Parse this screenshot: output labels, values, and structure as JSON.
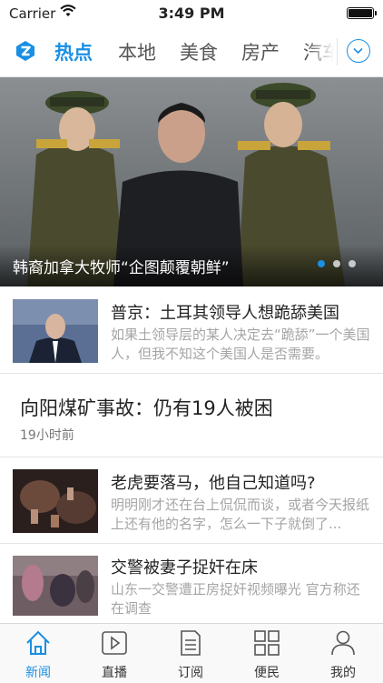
{
  "status_bar": {
    "carrier": "Carrier",
    "time": "3:49 PM"
  },
  "nav": {
    "tabs": [
      {
        "label": "热点",
        "active": true
      },
      {
        "label": "本地",
        "active": false
      },
      {
        "label": "美食",
        "active": false
      },
      {
        "label": "房产",
        "active": false
      },
      {
        "label": "汽车",
        "active": false
      }
    ],
    "logo_icon": "app-logo-icon",
    "expand_icon": "chevron-down-icon"
  },
  "hero": {
    "caption": "韩裔加拿大牧师“企图颠覆朝鲜”",
    "slide_count": 3,
    "active_slide": 1
  },
  "news": [
    {
      "title": "普京：土耳其领导人想跪舔美国",
      "summary": "如果土领导层的某人决定去“跪舔”一个美国人，但我不知这个美国人是否需要。"
    },
    {
      "title": "向阳煤矿事故：仍有19人被困",
      "time": "19小时前"
    },
    {
      "title": "老虎要落马，他自己知道吗?",
      "summary": "明明刚才还在台上侃侃而谈，或者今天报纸上还有他的名字，怎么一下子就倒了..."
    },
    {
      "title": "交警被妻子捉奸在床",
      "summary": "山东一交警遭正房捉奸视频曝光 官方称还在调查"
    }
  ],
  "tab_bar": [
    {
      "label": "新闻",
      "icon": "home-icon",
      "active": true
    },
    {
      "label": "直播",
      "icon": "play-icon",
      "active": false
    },
    {
      "label": "订阅",
      "icon": "document-icon",
      "active": false
    },
    {
      "label": "便民",
      "icon": "grid-icon",
      "active": false
    },
    {
      "label": "我的",
      "icon": "person-icon",
      "active": false
    }
  ],
  "colors": {
    "accent": "#1a8fe3",
    "text": "#222222",
    "muted": "#a5a5a5"
  }
}
